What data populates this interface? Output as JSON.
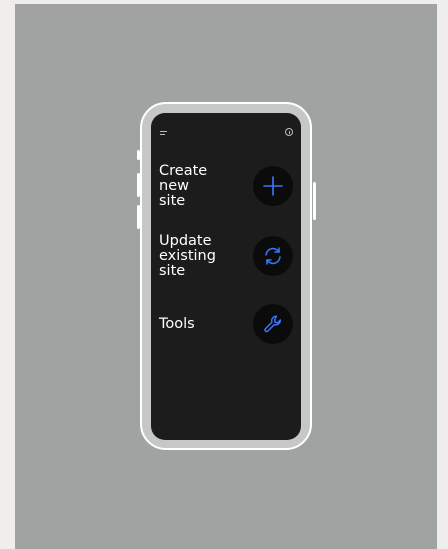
{
  "app": {
    "accent_color": "#3b78ff",
    "screen_background": "#1c1c1c"
  },
  "header": {
    "menu_icon": "menu-icon",
    "info_icon": "info-icon"
  },
  "options": [
    {
      "label": "Create\nnew\nsite",
      "icon": "plus-icon"
    },
    {
      "label": "Update\nexisting\nsite",
      "icon": "refresh-icon"
    },
    {
      "label": "Tools",
      "icon": "wrench-icon"
    }
  ]
}
